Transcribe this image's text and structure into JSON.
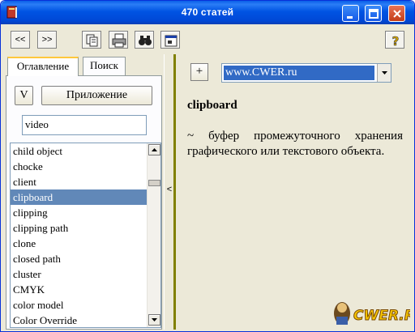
{
  "window": {
    "title": "470 статей"
  },
  "toolbar": {
    "prev_label": "<<",
    "next_label": ">>",
    "copy_icon": "copy-icon",
    "print_icon": "printer-icon",
    "find_icon": "binoculars-icon",
    "settings_icon": "properties-icon",
    "help_label": "?"
  },
  "left": {
    "tabs": [
      {
        "label": "Оглавление",
        "active": true
      },
      {
        "label": "Поиск",
        "active": false
      }
    ],
    "v_button_label": "V",
    "apply_button_label": "Приложение",
    "search_value": "video",
    "list_items": [
      "child object",
      "chocke",
      "client",
      "clipboard",
      "clipping",
      "clipping path",
      "clone",
      "closed path",
      "cluster",
      "CMYK",
      "color model",
      "Color Override"
    ],
    "selected_item": "clipboard",
    "splitter_label": "<"
  },
  "right": {
    "plus_label": "+",
    "source_value": "www.CWER.ru",
    "term": "clipboard",
    "definition": "~ буфер промежуточного хранения графического или текстового объекта."
  },
  "watermark": {
    "text": "CWER.RU"
  },
  "colors": {
    "titlebar": "#0054e3",
    "selection": "#6188b8",
    "divider": "#808000"
  }
}
